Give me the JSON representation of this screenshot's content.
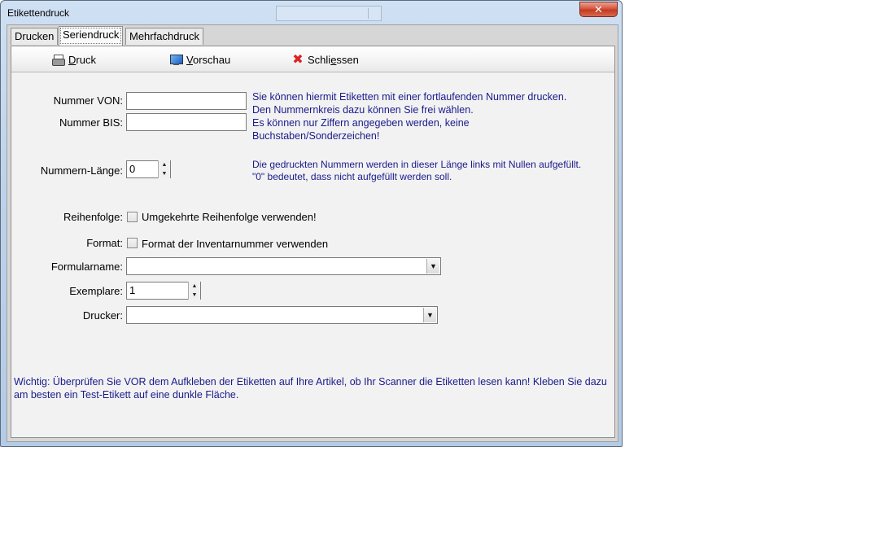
{
  "window": {
    "title": "Etikettendruck",
    "close_glyph": "✕"
  },
  "tabs": [
    {
      "label": "Drucken",
      "active": false
    },
    {
      "label": "Seriendruck",
      "active": true
    },
    {
      "label": "Mehrfachdruck",
      "active": false
    }
  ],
  "toolbar": {
    "print": {
      "icon": "printer-icon",
      "label_u": "D",
      "label_rest": "ruck"
    },
    "preview": {
      "icon": "monitor-icon",
      "label_u": "V",
      "label_rest": "orschau"
    },
    "close": {
      "icon": "close-x-icon",
      "glyph": "✖",
      "label_pre": "Schli",
      "label_u": "e",
      "label_rest": "ssen"
    }
  },
  "form": {
    "nummer_von": {
      "label": "Nummer VON:",
      "value": ""
    },
    "nummer_bis": {
      "label": "Nummer BIS:",
      "value": ""
    },
    "hint_nummern": [
      "Sie können hiermit Etiketten mit einer fortlaufenden Nummer drucken.",
      "Den Nummernkreis dazu können Sie frei wählen.",
      "Es können nur Ziffern angegeben werden, keine",
      "Buchstaben/Sonderzeichen!"
    ],
    "nummern_laenge": {
      "label": "Nummern-Länge:",
      "value": "0"
    },
    "hint_laenge": [
      "Die gedruckten Nummern werden in dieser Länge links mit Nullen aufgefüllt.",
      "\"0\" bedeutet, dass nicht aufgefüllt werden soll."
    ],
    "reihenfolge": {
      "label": "Reihenfolge:",
      "checkbox_label": "Umgekehrte Reihenfolge verwenden!",
      "checked": false
    },
    "format": {
      "label": "Format:",
      "checkbox_label": "Format der Inventarnummer verwenden",
      "checked": false
    },
    "formularname": {
      "label": "Formularname:",
      "value": ""
    },
    "exemplare": {
      "label": "Exemplare:",
      "value": "1"
    },
    "drucker": {
      "label": "Drucker:",
      "value": ""
    }
  },
  "warning": "Wichtig: Überprüfen Sie VOR dem Aufkleben der Etiketten auf Ihre Artikel, ob Ihr Scanner die Etiketten lesen kann! Kleben Sie dazu am besten ein Test-Etikett auf eine dunkle Fläche.",
  "glyphs": {
    "spin_up": "▲",
    "spin_down": "▼",
    "dropdown": "▼"
  }
}
